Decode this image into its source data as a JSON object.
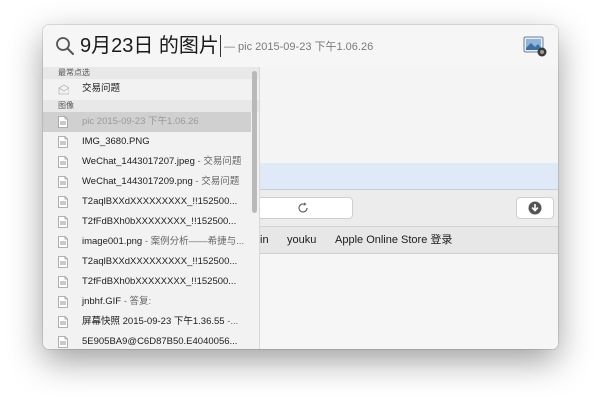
{
  "search": {
    "query": "9月23日 的图片",
    "hint": "— pic 2015-09-23 下午1.06.26"
  },
  "sections": {
    "top_hit": "最常点选",
    "images": "图像"
  },
  "top_hit_item": {
    "title": "交易问题"
  },
  "results": [
    {
      "name": "pic 2015-09-23 下午1.06.26",
      "sub": ""
    },
    {
      "name": "IMG_3680.PNG",
      "sub": ""
    },
    {
      "name": "WeChat_1443017207.jpeg",
      "sub": " - 交易问题"
    },
    {
      "name": "WeChat_1443017209.png",
      "sub": " - 交易问题"
    },
    {
      "name": "T2aqlBXXdXXXXXXXXX_!!152500...",
      "sub": ""
    },
    {
      "name": "T2fFdBXh0bXXXXXXXX_!!152500...",
      "sub": ""
    },
    {
      "name": "image001.png",
      "sub": " - 案例分析——希捷与..."
    },
    {
      "name": "T2aqlBXXdXXXXXXXXX_!!152500...",
      "sub": ""
    },
    {
      "name": "T2fFdBXh0bXXXXXXXX_!!152500...",
      "sub": ""
    },
    {
      "name": "jnbhf.GIF",
      "sub": " - 答复:"
    },
    {
      "name": "屏幕快照 2015-09-23 下午1.36.55",
      "sub": " -..."
    },
    {
      "name": "5E905BA9@C6D87B50.E4040056...",
      "sub": ""
    }
  ],
  "preview": {
    "bookmarks": [
      "in",
      "youku",
      "Apple Online Store 登录"
    ]
  }
}
